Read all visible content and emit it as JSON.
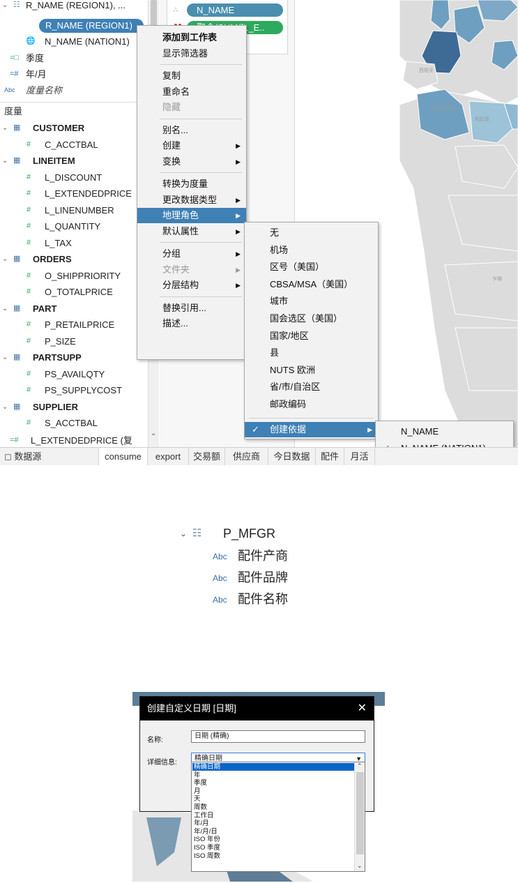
{
  "colors": {
    "accent": "#3f80b5",
    "pill_teal": "#4a8fae",
    "pill_green": "#2eaa5e",
    "dialog_title_bg": "#000000",
    "list_selection": "#0a64c8"
  },
  "panel1": {
    "tree": {
      "hierarchy_label": "R_NAME (REGION1), ...",
      "selected_item": "R_NAME (REGION1)",
      "nation_item": "N_NAME (NATION1)",
      "season": "季度",
      "year_month": "年/月",
      "measure_names": "度量名称",
      "measures_header": "度量",
      "abc_tag": "Abc",
      "tables": [
        {
          "name": "CUSTOMER",
          "fields": [
            "C_ACCTBAL"
          ]
        },
        {
          "name": "LINEITEM",
          "fields": [
            "L_DISCOUNT",
            "L_EXTENDEDPRICE",
            "L_LINENUMBER",
            "L_QUANTITY",
            "L_TAX"
          ]
        },
        {
          "name": "ORDERS",
          "fields": [
            "O_SHIPPRIORITY",
            "O_TOTALPRICE"
          ]
        },
        {
          "name": "PART",
          "fields": [
            "P_RETAILPRICE",
            "P_SIZE"
          ]
        },
        {
          "name": "PARTSUPP",
          "fields": [
            "PS_AVAILQTY",
            "PS_SUPPLYCOST"
          ]
        },
        {
          "name": "SUPPLIER",
          "fields": [
            "S_ACCTBAL"
          ]
        }
      ],
      "last_item": "L_EXTENDEDPRICE (复"
    },
    "shelf": {
      "pill1": "N_NAME",
      "pill2": "聚合(SUM([L_E.."
    },
    "context_menu": [
      "添加到工作表",
      "显示筛选器",
      "复制",
      "重命名",
      "隐藏",
      "别名...",
      "创建",
      "变换",
      "转换为度量",
      "更改数据类型",
      "地理角色",
      "默认属性",
      "分组",
      "文件夹",
      "分层结构",
      "替换引用...",
      "描述..."
    ],
    "geo_submenu": [
      "无",
      "机场",
      "区号（美国）",
      "CBSA/MSA（美国）",
      "城市",
      "国会选区（美国）",
      "国家/地区",
      "县",
      "NUTS 欧洲",
      "省/市/自治区",
      "邮政编码",
      "创建依据"
    ],
    "create_from_submenu": [
      "N_NAME",
      "N_NAME (NATION1)"
    ],
    "tabs": [
      "数据源",
      "consume",
      "export",
      "交易额",
      "供应商",
      "今日数据",
      "配件",
      "月活"
    ],
    "map_labels": [
      "西班牙",
      "阿尔及利亚",
      "利比亚",
      "乍得"
    ]
  },
  "panel2": {
    "hierarchy": "P_MFGR",
    "abc_tag": "Abc",
    "items": [
      "配件产商",
      "配件品牌",
      "配件名称"
    ]
  },
  "panel3": {
    "title": "创建自定义日期 [日期]",
    "name_label": "名称:",
    "name_value": "日期 (精确)",
    "detail_label": "详细信息:",
    "detail_value": "精确日期",
    "options": [
      "精确日期",
      "年",
      "季度",
      "月",
      "天",
      "周数",
      "工作日",
      "年/月",
      "年/月/日",
      "ISO 年份",
      "ISO 季度",
      "ISO 周数"
    ]
  }
}
